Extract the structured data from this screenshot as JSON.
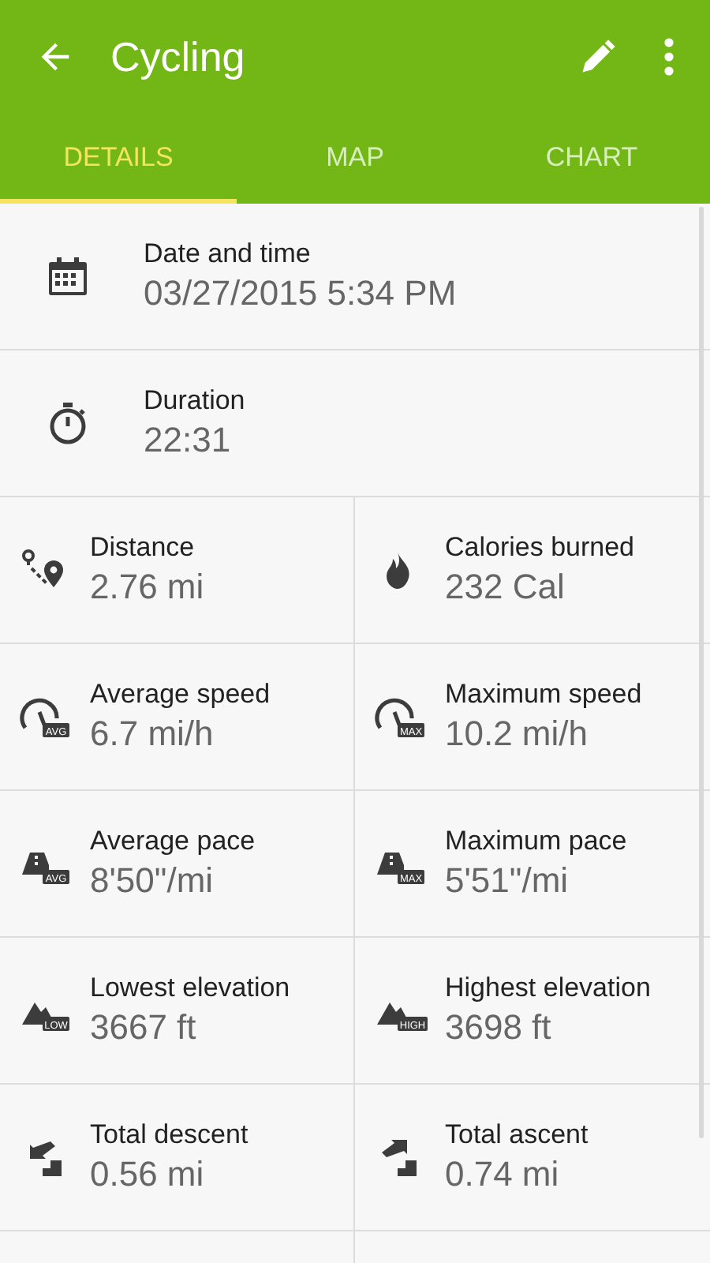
{
  "app_bar": {
    "title": "Cycling"
  },
  "tabs": [
    {
      "label": "DETAILS",
      "selected": true
    },
    {
      "label": "MAP",
      "selected": false
    },
    {
      "label": "CHART",
      "selected": false
    }
  ],
  "full_rows": [
    {
      "kind": "calendar",
      "label": "Date and time",
      "value": "03/27/2015 5:34 PM"
    },
    {
      "kind": "stopwatch",
      "label": "Duration",
      "value": "22:31"
    }
  ],
  "grid": [
    {
      "kind": "route",
      "label": "Distance",
      "value": "2.76 mi"
    },
    {
      "kind": "flame",
      "label": "Calories burned",
      "value": "232 Cal"
    },
    {
      "kind": "gauge",
      "badge": "AVG",
      "label": "Average speed",
      "value": "6.7 mi/h"
    },
    {
      "kind": "gauge",
      "badge": "MAX",
      "label": "Maximum speed",
      "value": "10.2 mi/h"
    },
    {
      "kind": "pace",
      "badge": "AVG",
      "label": "Average pace",
      "value": "8'50\"/mi"
    },
    {
      "kind": "pace",
      "badge": "MAX",
      "label": "Maximum pace",
      "value": "5'51\"/mi"
    },
    {
      "kind": "mountain",
      "badge": "LOW",
      "label": "Lowest elevation",
      "value": "3667 ft"
    },
    {
      "kind": "mountain",
      "badge": "HIGH",
      "label": "Highest elevation",
      "value": "3698 ft"
    },
    {
      "kind": "descent",
      "label": "Total descent",
      "value": "0.56 mi"
    },
    {
      "kind": "ascent",
      "label": "Total ascent",
      "value": "0.74 mi"
    }
  ]
}
